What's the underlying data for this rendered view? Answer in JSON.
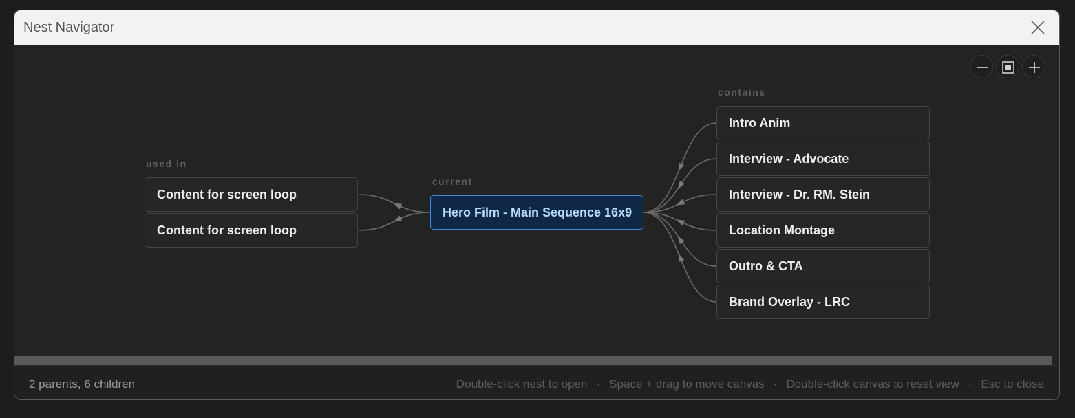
{
  "window": {
    "title": "Nest Navigator",
    "close_icon": "close-icon"
  },
  "zoom": {
    "out_icon": "minus-icon",
    "fit_icon": "fit-view-icon",
    "in_icon": "plus-icon"
  },
  "graph": {
    "used_in_label": "used in",
    "current_label": "current",
    "contains_label": "contains",
    "parents": [
      "Content for screen loop",
      "Content for screen loop"
    ],
    "current": "Hero Film - Main Sequence 16x9",
    "children": [
      "Intro Anim",
      "Interview - Advocate",
      "Interview - Dr. RM. Stein",
      "Location Montage",
      "Outro & CTA",
      "Brand Overlay - LRC"
    ]
  },
  "status": {
    "summary": "2 parents, 6 children",
    "hints": [
      "Double-click nest to open",
      "Space + drag to move canvas",
      "Double-click canvas to reset view",
      "Esc to close"
    ],
    "separator": "·"
  },
  "colors": {
    "current_border": "#3f8fd8",
    "current_fill": "#0e2846",
    "edge": "#6a6a6a"
  }
}
